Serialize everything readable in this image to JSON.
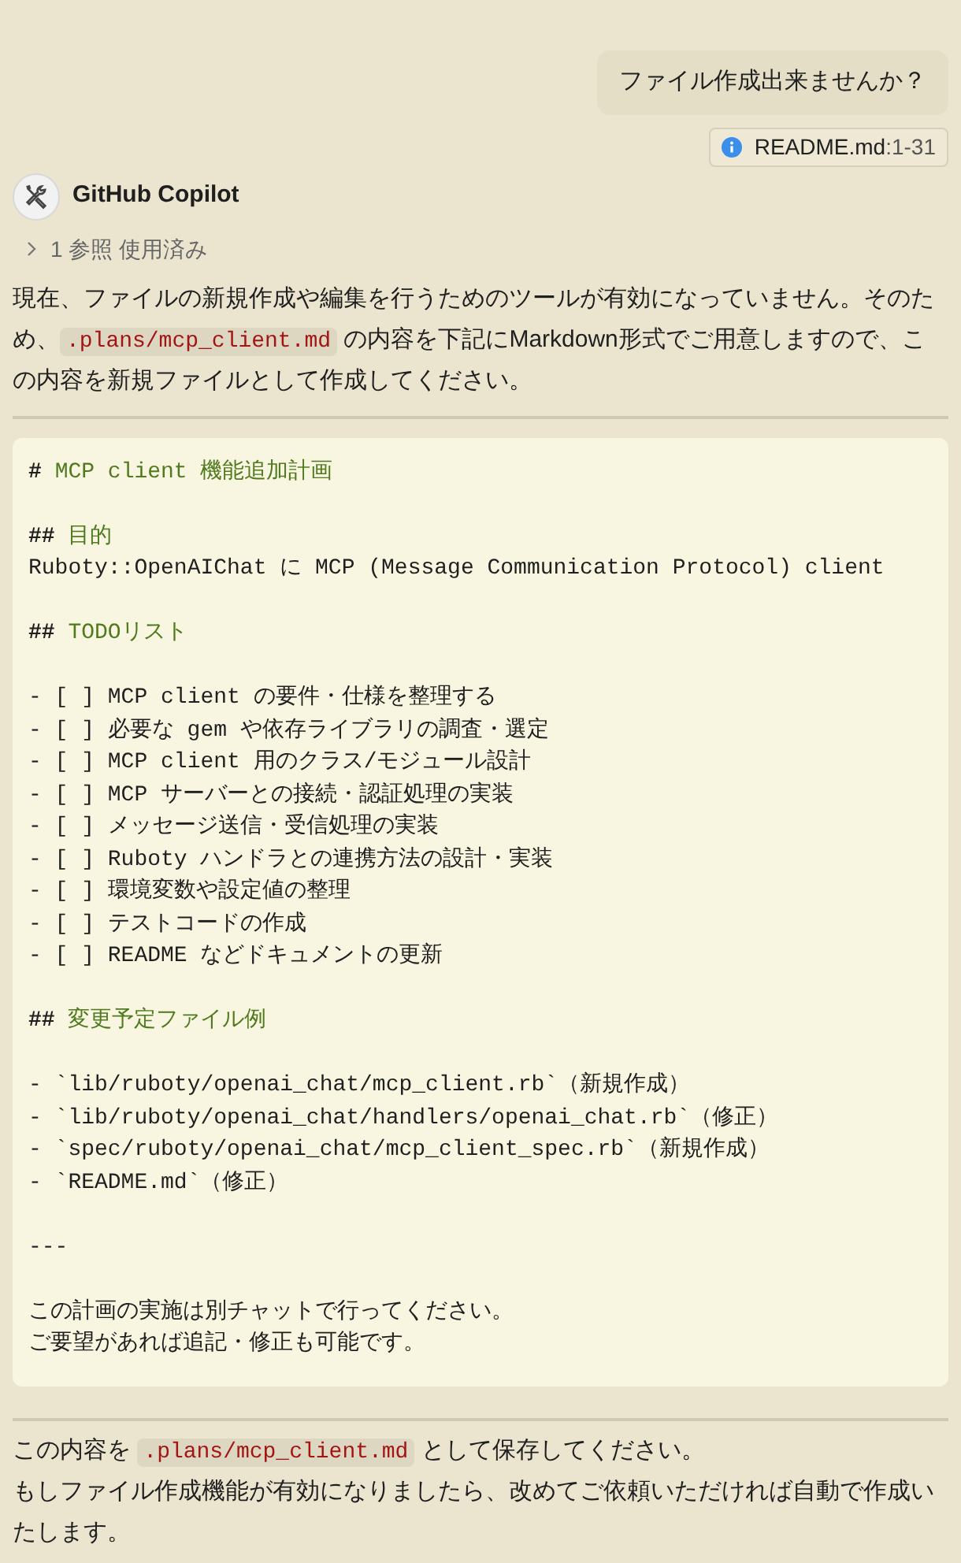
{
  "user_message": {
    "text": "ファイル作成出来ませんか？",
    "reference": {
      "file": "README.md",
      "range": ":1-31"
    }
  },
  "assistant": {
    "name": "GitHub Copilot",
    "references": {
      "label": "1 参照 使用済み",
      "expanded": false
    },
    "intro": [
      {
        "text": "現在、ファイルの新規作成や編集を行うためのツールが有効になっていません。そのため、"
      },
      {
        "code": ".plans/mcp_client.md"
      },
      {
        "text": " の内容を下記にMarkdown形式でご用意しますので、この内容を新規ファイルとして作成してください。"
      }
    ],
    "code_block": [
      {
        "kind": "heading",
        "marker": "#",
        "text": "MCP client 機能追加計画"
      },
      {
        "kind": "blank"
      },
      {
        "kind": "heading",
        "marker": "##",
        "text": "目的"
      },
      {
        "kind": "text",
        "text": "Ruboty::OpenAIChat に MCP (Message Communication Protocol) client"
      },
      {
        "kind": "blank"
      },
      {
        "kind": "heading",
        "marker": "##",
        "text": "TODOリスト"
      },
      {
        "kind": "blank"
      },
      {
        "kind": "text",
        "text": "- [ ] MCP client の要件・仕様を整理する"
      },
      {
        "kind": "text",
        "text": "- [ ] 必要な gem や依存ライブラリの調査・選定"
      },
      {
        "kind": "text",
        "text": "- [ ] MCP client 用のクラス/モジュール設計"
      },
      {
        "kind": "text",
        "text": "- [ ] MCP サーバーとの接続・認証処理の実装"
      },
      {
        "kind": "text",
        "text": "- [ ] メッセージ送信・受信処理の実装"
      },
      {
        "kind": "text",
        "text": "- [ ] Ruboty ハンドラとの連携方法の設計・実装"
      },
      {
        "kind": "text",
        "text": "- [ ] 環境変数や設定値の整理"
      },
      {
        "kind": "text",
        "text": "- [ ] テストコードの作成"
      },
      {
        "kind": "text",
        "text": "- [ ] README などドキュメントの更新"
      },
      {
        "kind": "blank"
      },
      {
        "kind": "heading",
        "marker": "##",
        "text": "変更予定ファイル例"
      },
      {
        "kind": "blank"
      },
      {
        "kind": "text",
        "text": "- `lib/ruboty/openai_chat/mcp_client.rb`（新規作成）"
      },
      {
        "kind": "text",
        "text": "- `lib/ruboty/openai_chat/handlers/openai_chat.rb`（修正）"
      },
      {
        "kind": "text",
        "text": "- `spec/ruboty/openai_chat/mcp_client_spec.rb`（新規作成）"
      },
      {
        "kind": "text",
        "text": "- `README.md`（修正）"
      },
      {
        "kind": "blank"
      },
      {
        "kind": "text",
        "text": "---"
      },
      {
        "kind": "blank"
      },
      {
        "kind": "text",
        "text": "この計画の実施は別チャットで行ってください。"
      },
      {
        "kind": "text",
        "text": "ご要望があれば追記・修正も可能です。"
      }
    ],
    "outro": [
      [
        {
          "text": "この内容を "
        },
        {
          "code": ".plans/mcp_client.md"
        },
        {
          "text": " として保存してください。"
        }
      ],
      [
        {
          "text": "もしファイル作成機能が有効になりましたら、改めてご依頼いただければ自動で作成いたします。"
        }
      ]
    ]
  }
}
